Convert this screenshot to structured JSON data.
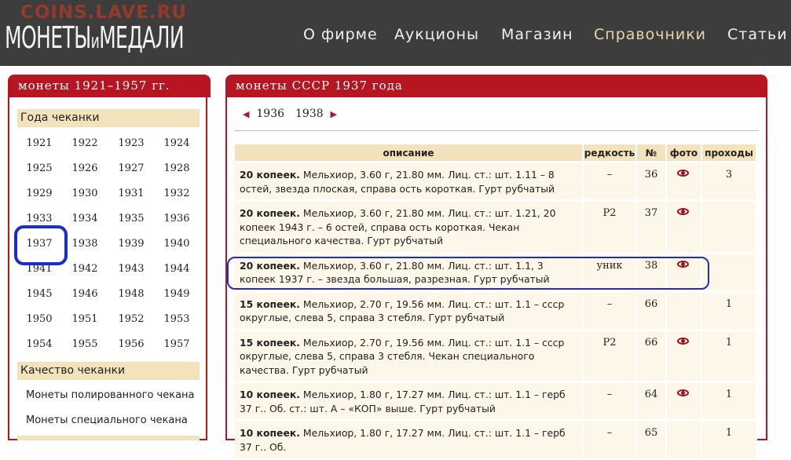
{
  "site": {
    "watermark": "COINS.LAVE.RU",
    "logo_part1": "МОНЕТЫ",
    "logo_mid": "и",
    "logo_part2": "МЕДАЛИ"
  },
  "nav": {
    "items": [
      {
        "label": "О фирме",
        "active": false
      },
      {
        "label": "Аукционы",
        "active": false
      },
      {
        "label": "Магазин",
        "active": false
      },
      {
        "label": "Справочники",
        "active": true
      },
      {
        "label": "Статьи",
        "active": false
      }
    ]
  },
  "left_panel": {
    "title": "монеты 1921–1957 гг.",
    "years_title": "Года чеканки",
    "years": [
      "1921",
      "1922",
      "1923",
      "1924",
      "1925",
      "1926",
      "1927",
      "1928",
      "1929",
      "1930",
      "1931",
      "1932",
      "1933",
      "1934",
      "1935",
      "1936",
      "1937",
      "1938",
      "1939",
      "1940",
      "1941",
      "1942",
      "1943",
      "1944",
      "1945",
      "1946",
      "1948",
      "1949",
      "1950",
      "1951",
      "1952",
      "1953",
      "1954",
      "1955",
      "1956",
      "1957"
    ],
    "selected_year": "1937",
    "quality_title": "Качество чеканки",
    "quality_links": [
      "Монеты полированного чекана",
      "Монеты специального чекана"
    ]
  },
  "right_panel": {
    "title": "монеты СССР 1937 года",
    "prev_year": "1936",
    "next_year": "1938",
    "columns": [
      "описание",
      "редкость",
      "№",
      "фото",
      "проходы"
    ],
    "rows": [
      {
        "title": "20 копеек.",
        "desc": "Мельхиор, 3.60 г, 21.80 мм. Лиц. ст.: шт. 1.11 – 8 остей, звезда плоская, справа ость короткая. Гурт рубчатый",
        "rarity": "–",
        "num": "36",
        "photo": true,
        "sales": "3"
      },
      {
        "title": "20 копеек.",
        "desc": "Мельхиор, 3.60 г, 21.80 мм. Лиц. ст.: шт. 1.21, 20 копеек 1943 г. – 6 остей, справа ость короткая. Чекан специального качества. Гурт рубчатый",
        "rarity": "Р2",
        "num": "37",
        "photo": true,
        "sales": ""
      },
      {
        "title": "20 копеек.",
        "desc": "Мельхиор, 3.60 г, 21.80 мм. Лиц. ст.: шт. 1.1, 3 копеек 1937 г. – звезда большая, разрезная. Гурт рубчатый",
        "rarity": "уник",
        "num": "38",
        "photo": true,
        "sales": ""
      },
      {
        "title": "15 копеек.",
        "desc": "Мельхиор, 2.70 г, 19.56 мм. Лиц. ст.: шт. 1.1 – ссср округлые, слева 5, справа 3 стебля. Гурт рубчатый",
        "rarity": "–",
        "num": "66",
        "photo": false,
        "sales": "1"
      },
      {
        "title": "15 копеек.",
        "desc": "Мельхиор, 2.70 г, 19.56 мм. Лиц. ст.: шт. 1.1 – ссср округлые, слева 5, справа 3 стебля. Чекан специального качества. Гурт рубчатый",
        "rarity": "Р2",
        "num": "66",
        "photo": true,
        "sales": "1"
      },
      {
        "title": "10 копеек.",
        "desc": "Мельхиор, 1.80 г, 17.27 мм. Лиц. ст.: шт. 1.1 – герб 37 г.. Об. ст.: шт. А – «КОП» выше. Гурт рубчатый",
        "rarity": "–",
        "num": "64",
        "photo": true,
        "sales": "1"
      },
      {
        "title": "10 копеек.",
        "desc": "Мельхиор, 1.80 г, 17.27 мм. Лиц. ст.: шт. 1.1 – герб 37 г.. Об.",
        "rarity": "–",
        "num": "65",
        "photo": false,
        "sales": "1"
      }
    ]
  }
}
